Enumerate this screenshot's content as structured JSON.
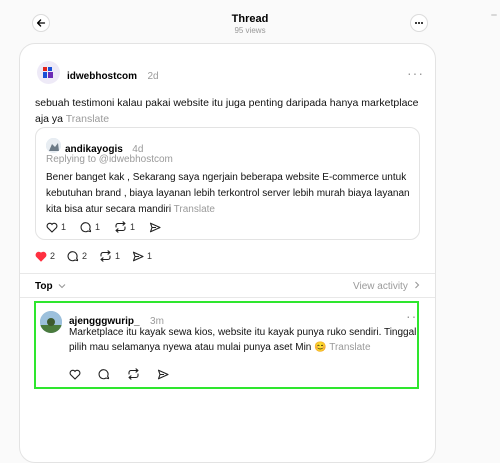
{
  "header": {
    "title": "Thread",
    "views": "95 views"
  },
  "main_post": {
    "username": "idwebhostcom",
    "time": "2d",
    "text": "sebuah testimoni kalau pakai website itu juga penting daripada hanya marketplace aja ya",
    "translate": "Translate",
    "likes": "2",
    "replies": "2",
    "reposts": "1",
    "shares": "1"
  },
  "quoted_post": {
    "username": "andikayogis",
    "time": "4d",
    "replying_to": "Replying to @idwebhostcom",
    "text": "Bener banget kak , Sekarang saya ngerjain beberapa website E-commerce untuk kebutuhan brand , biaya layanan lebih terkontrol server lebih murah biaya layanan kita bisa atur secara mandiri",
    "translate": "Translate",
    "likes": "1",
    "replies": "1",
    "reposts": "1"
  },
  "sort": {
    "label": "Top",
    "view_activity": "View activity"
  },
  "reply": {
    "username": "ajengggwurip_",
    "time": "3m",
    "text": "Marketplace itu kayak sewa kios, website itu kayak punya ruko sendiri. Tinggal pilih mau selamanya nyewa atau mulai punya aset Min 😊",
    "translate": "Translate"
  },
  "colors": {
    "like_active": "#ff3040",
    "highlight": "#2ee62e",
    "muted": "#9a9a9a"
  }
}
